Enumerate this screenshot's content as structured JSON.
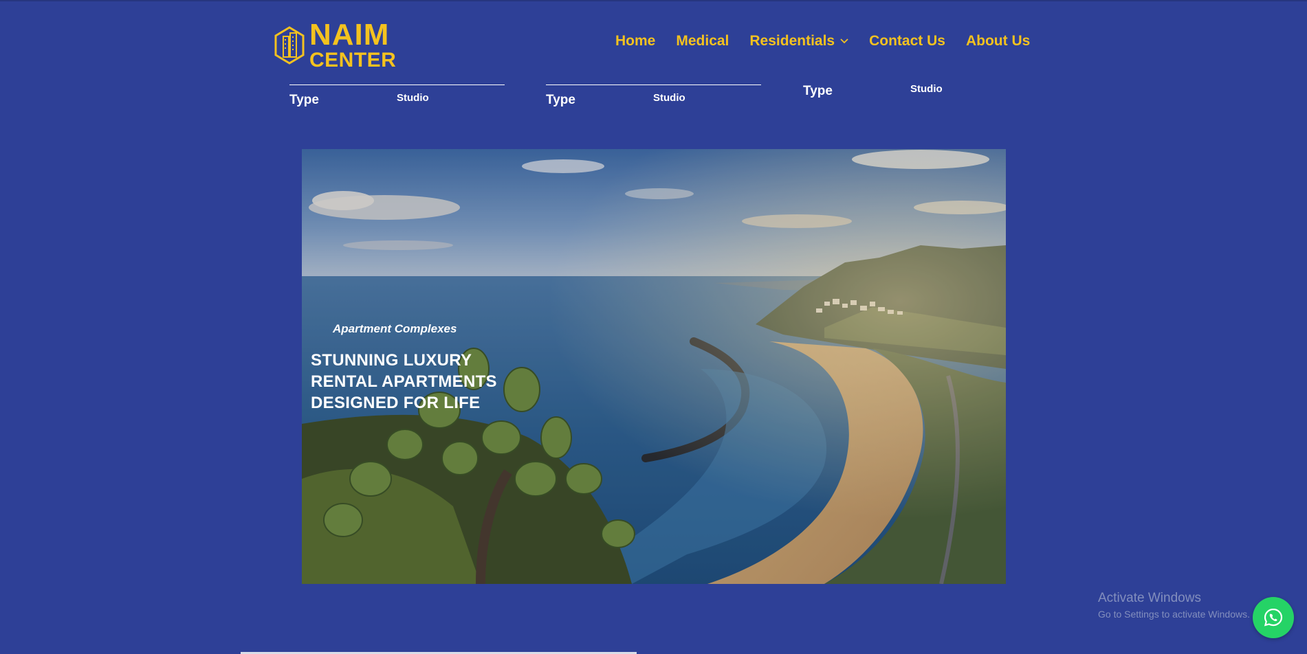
{
  "brand": {
    "line1": "NAIM",
    "line2": "CENTER",
    "logo_icon": "building-hexagon-icon",
    "color": "#f4c21f"
  },
  "nav": {
    "items": [
      {
        "label": "Home"
      },
      {
        "label": "Medical"
      },
      {
        "label": "Residentials",
        "has_dropdown": true
      },
      {
        "label": "Contact Us"
      },
      {
        "label": "About Us"
      }
    ]
  },
  "filters": [
    {
      "label": "Type",
      "value": "Studio"
    },
    {
      "label": "Type",
      "value": "Studio"
    },
    {
      "label": "Type",
      "value": "Studio"
    }
  ],
  "hero": {
    "eyebrow": "Apartment Complexes",
    "title": "STUNNING LUXURY RENTAL APARTMENTS DESIGNED FOR LIFE"
  },
  "watermark": {
    "title": "Activate Windows",
    "subtitle": "Go to Settings to activate Windows."
  },
  "whatsapp": {
    "icon": "whatsapp-icon"
  },
  "colors": {
    "background": "#2e4097",
    "accent": "#f4c21f",
    "whatsapp": "#25d366"
  }
}
